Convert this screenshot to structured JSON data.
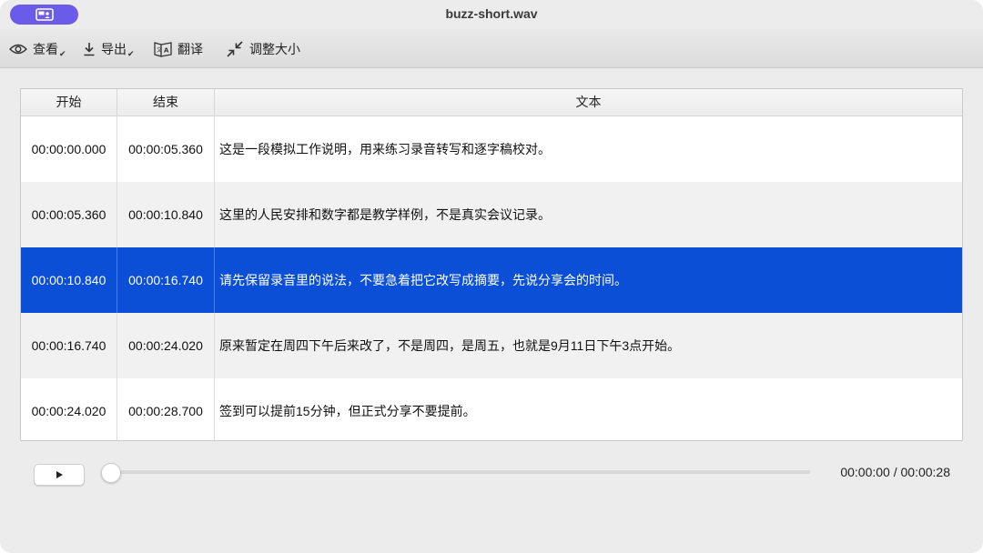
{
  "window": {
    "title": "buzz-short.wav",
    "accent_color": "#6a5be8",
    "sidebar_button_icon": "sidebar-toggle-icon"
  },
  "toolbar": {
    "items": [
      {
        "label": "查看",
        "icon": "eye-icon",
        "has_menu": true
      },
      {
        "label": "导出",
        "icon": "download-icon",
        "has_menu": true
      },
      {
        "label": "翻译",
        "icon": "translate-icon",
        "has_menu": false
      },
      {
        "label": "调整大小",
        "icon": "shrink-icon",
        "has_menu": false
      }
    ]
  },
  "table": {
    "columns": [
      "开始",
      "结束",
      "文本"
    ],
    "selected_row": 2,
    "selected_color": "#0a4fd6",
    "rows": [
      {
        "start": "00:00:00.000",
        "end": "00:00:05.360",
        "text": "这是一段模拟工作说明，用来练习录音转写和逐字稿校对。"
      },
      {
        "start": "00:00:05.360",
        "end": "00:00:10.840",
        "text": "这里的人民安排和数字都是教学样例，不是真实会议记录。"
      },
      {
        "start": "00:00:10.840",
        "end": "00:00:16.740",
        "text": "请先保留录音里的说法，不要急着把它改写成摘要，先说分享会的时间。"
      },
      {
        "start": "00:00:16.740",
        "end": "00:00:24.020",
        "text": "原来暂定在周四下午后来改了，不是周四，是周五，也就是9月11日下午3点开始。"
      },
      {
        "start": "00:00:24.020",
        "end": "00:00:28.700",
        "text": "签到可以提前15分钟，但正式分享不要提前。"
      }
    ]
  },
  "player": {
    "play_icon": "play-icon",
    "time_display": "00:00:00 / 00:00:28",
    "progress": 0
  }
}
